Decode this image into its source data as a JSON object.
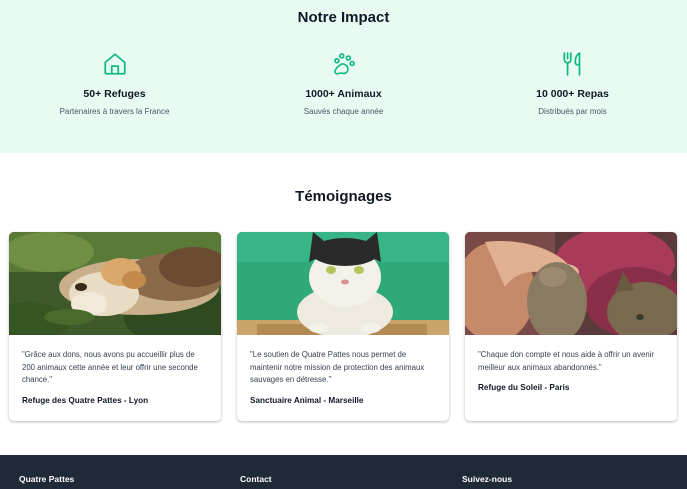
{
  "impact": {
    "title": "Notre Impact",
    "stats": [
      {
        "icon": "home-icon",
        "value": "50+ Refuges",
        "desc": "Partenaires à travers la France"
      },
      {
        "icon": "paw-icon",
        "value": "1000+ Animaux",
        "desc": "Sauvés chaque année"
      },
      {
        "icon": "utensils-icon",
        "value": "10 000+ Repas",
        "desc": "Distribués par mois"
      }
    ]
  },
  "testimonials": {
    "title": "Témoignages",
    "items": [
      {
        "quote": "\"Grâce aux dons, nous avons pu accueillir plus de 200 animaux cette année et leur offrir une seconde chance.\"",
        "author": "Refuge des Quatre Pattes - Lyon"
      },
      {
        "quote": "\"Le soutien de Quatre Pattes nous permet de maintenir notre mission de protection des animaux sauvages en détresse.\"",
        "author": "Sanctuaire Animal - Marseille"
      },
      {
        "quote": "\"Chaque don compte et nous aide à offrir un avenir meilleur aux animaux abandonnés.\"",
        "author": "Refuge du Soleil - Paris"
      }
    ]
  },
  "footer": {
    "col1": "Quatre Pattes",
    "col2": "Contact",
    "col3": "Suivez-nous"
  },
  "colors": {
    "accent": "#10b981",
    "impact_bg": "#e8fbf3",
    "footer_bg": "#1f2937"
  }
}
